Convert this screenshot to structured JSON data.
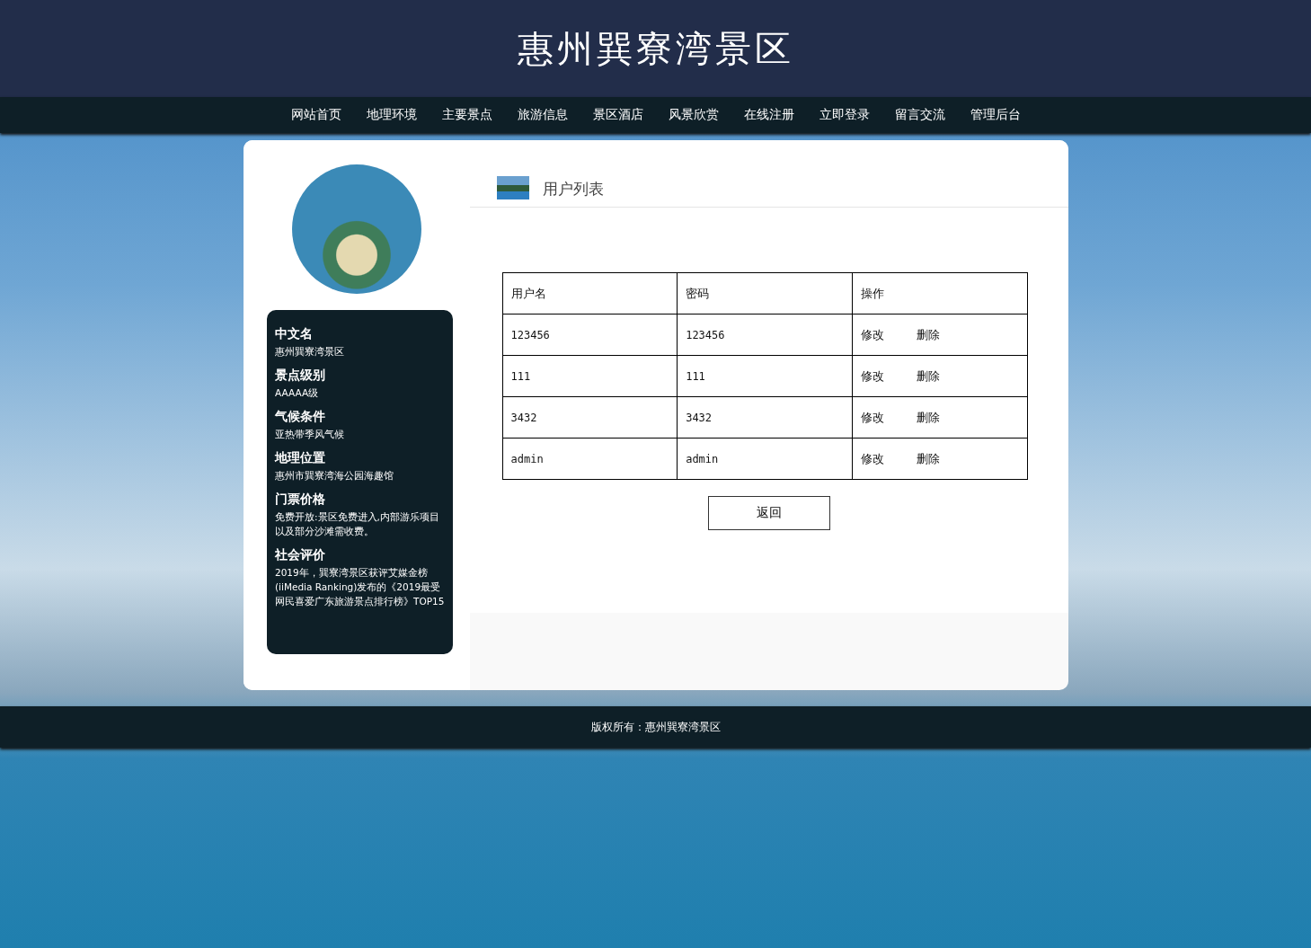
{
  "site_title": "惠州巽寮湾景区",
  "nav": [
    "网站首页",
    "地理环境",
    "主要景点",
    "旅游信息",
    "景区酒店",
    "风景欣赏",
    "在线注册",
    "立即登录",
    "留言交流",
    "管理后台"
  ],
  "sidebar": {
    "items": [
      {
        "heading": "中文名",
        "text": "惠州巽寮湾景区"
      },
      {
        "heading": "景点级别",
        "text": "AAAAA级"
      },
      {
        "heading": "气候条件",
        "text": "亚热带季风气候"
      },
      {
        "heading": "地理位置",
        "text": "惠州市巽寮湾海公园海趣馆"
      },
      {
        "heading": "门票价格",
        "text": "免费开放:景区免费进入,内部游乐项目以及部分沙滩需收费。"
      },
      {
        "heading": "社会评价",
        "text": "2019年，巽寮湾景区获评艾媒金榜(iiMedia Ranking)发布的《2019最受网民喜爱广东旅游景点排行榜》TOP15"
      }
    ]
  },
  "panel": {
    "title": "用户列表"
  },
  "table": {
    "columns": [
      "用户名",
      "密码",
      "操作"
    ],
    "rows": [
      {
        "username": "123456",
        "password": "123456",
        "actions": [
          "修改",
          "删除"
        ]
      },
      {
        "username": "111",
        "password": "111",
        "actions": [
          "修改",
          "删除"
        ]
      },
      {
        "username": "3432",
        "password": "3432",
        "actions": [
          "修改",
          "删除"
        ]
      },
      {
        "username": "admin",
        "password": "admin",
        "actions": [
          "修改",
          "删除"
        ]
      }
    ]
  },
  "back_button": "返回",
  "footer": "版权所有：惠州巽寮湾景区"
}
